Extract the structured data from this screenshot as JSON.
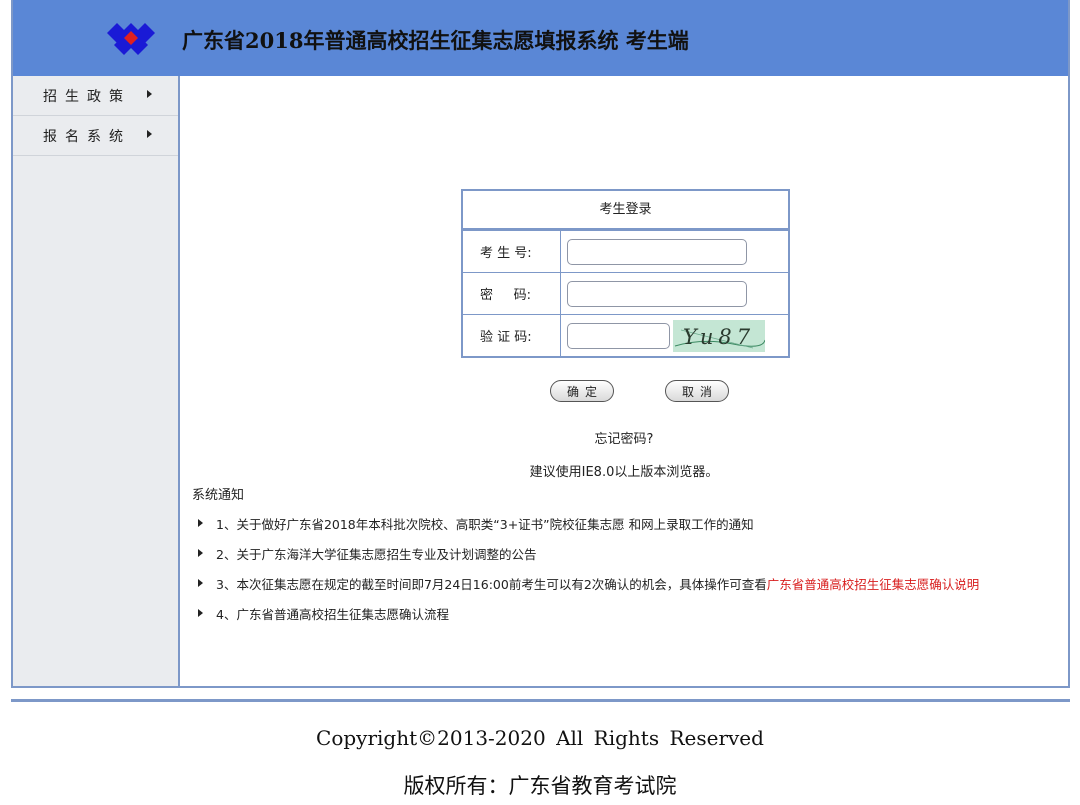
{
  "header": {
    "title": "广东省2018年普通高校招生征集志愿填报系统  考生端",
    "logo_icon": "diamond-cluster-logo",
    "bg_color": "#5a87d6"
  },
  "sidebar": {
    "items": [
      {
        "label": "招生政策"
      },
      {
        "label": "报名系统"
      }
    ]
  },
  "login": {
    "title": "考生登录",
    "fields": [
      {
        "label": "考 生 号:",
        "value": "",
        "placeholder": ""
      },
      {
        "label": "密     码:",
        "value": "",
        "placeholder": ""
      },
      {
        "label": "验 证 码:",
        "value": "",
        "placeholder": ""
      }
    ],
    "captcha_text": "Yu87",
    "confirm_label": "确定",
    "cancel_label": "取消",
    "forgot_label": "忘记密码?",
    "browser_tip": "建议使用IE8.0以上版本浏览器。"
  },
  "notices": {
    "title": "系统通知",
    "items": [
      {
        "text": "1、关于做好广东省2018年本科批次院校、高职类“3+证书”院校征集志愿 和网上录取工作的通知",
        "link": ""
      },
      {
        "text": "2、关于广东海洋大学征集志愿招生专业及计划调整的公告",
        "link": ""
      },
      {
        "text": "3、本次征集志愿在规定的截至时间即7月24日16:00前考生可以有2次确认的机会，具体操作可查看",
        "link": "广东省普通高校招生征集志愿确认说明"
      },
      {
        "text": "4、广东省普通高校招生征集志愿确认流程",
        "link": ""
      }
    ]
  },
  "footer": {
    "copyright": "Copyright©2013-2020   All  Rights  Reserved",
    "owner": "版权所有：广东省教育考试院"
  },
  "colors": {
    "accent": "#7d98c8",
    "link_red": "#d81e1e"
  }
}
